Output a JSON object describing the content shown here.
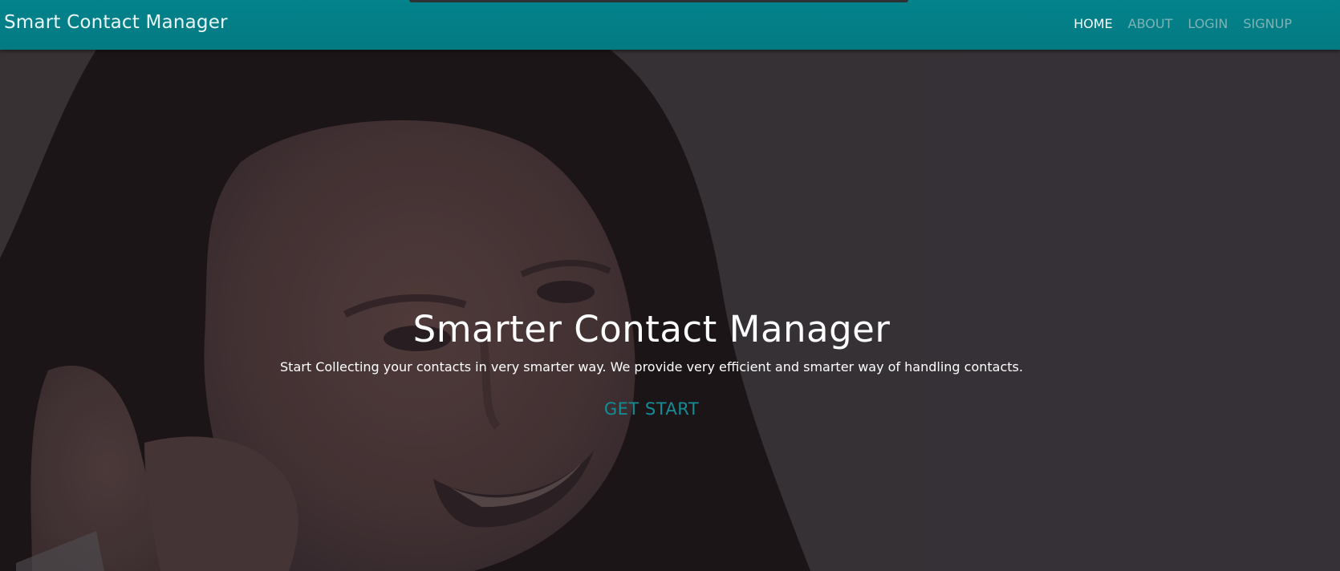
{
  "navbar": {
    "brand": "Smart Contact Manager",
    "links": [
      {
        "label": "HOME",
        "active": true
      },
      {
        "label": "ABOUT",
        "active": false
      },
      {
        "label": "LOGIN",
        "active": false
      },
      {
        "label": "SIGNUP",
        "active": false
      }
    ]
  },
  "hero": {
    "title": "Smarter Contact Manager",
    "subtitle": "Start Collecting your contacts in very smarter way. We provide very efficient and smarter way of handling contacts.",
    "cta_label": "GET START",
    "background_image": "smiling-woman-on-phone-photo"
  },
  "colors": {
    "navbar": "#047f87",
    "accent": "#148e96",
    "overlay": "#3b373c"
  }
}
